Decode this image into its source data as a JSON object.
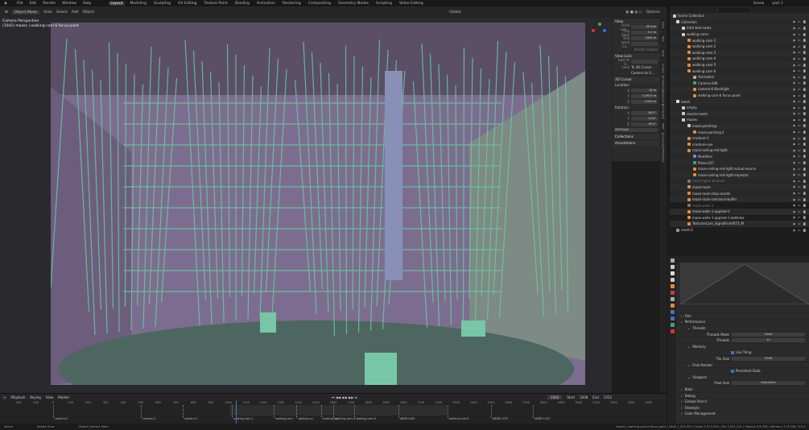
{
  "menu": [
    "File",
    "Edit",
    "Render",
    "Window",
    "Help"
  ],
  "workspaces": [
    "Layout",
    "Modeling",
    "Sculpting",
    "UV Editing",
    "Texture Paint",
    "Shading",
    "Animation",
    "Rendering",
    "Compositing",
    "Geometry Nodes",
    "Scripting",
    "Video Editing"
  ],
  "active_workspace": "Layout",
  "scene": "Scene",
  "view_layer": "part 1",
  "header": {
    "mode": "Object Mode",
    "view": "View",
    "select": "Select",
    "add": "Add",
    "object": "Object",
    "orientation": "Global",
    "options": "Options"
  },
  "viewport": {
    "title": "Camera Perspective",
    "subtitle": "(1042) mazes | walking-cam-6 focus-point"
  },
  "npanel": {
    "view_title": "View",
    "focal_label": "Focal Len...",
    "focal": "50 mm",
    "clip_start_label": "Clip Start",
    "clip_start": "0.1 m",
    "end_label": "End",
    "end": "1000 m",
    "local_label": "Local Ca...",
    "render_region": "Render Region",
    "view_lock": "View Lock",
    "lock_to_label": "Lock to O...",
    "lock_label": "Lock",
    "to_3d_cursor": "To 3D Cursor",
    "camera_to_view": "Camera to V...",
    "cursor_title": "3D Cursor",
    "location": "Location:",
    "loc": [
      [
        "X",
        "10 m"
      ],
      [
        "Y",
        "0.0973 m"
      ],
      [
        "Z",
        "2.953 m"
      ]
    ],
    "rotation": "Rotation:",
    "rot": [
      [
        "X",
        "84.2°"
      ],
      [
        "Y",
        "0.14°"
      ],
      [
        "Z",
        "45.2°"
      ]
    ],
    "rot_mode": "XYZ Euler",
    "collections": "Collections",
    "annotations": "Annotations"
  },
  "ntabs": [
    "Item",
    "Tool",
    "View",
    "Create",
    "Animation",
    "Relations",
    "BlenderKit",
    "AMP",
    "Screencast",
    "Modifiers"
  ],
  "outliner": {
    "root": "Scene Collection",
    "rows": [
      {
        "name": "Collection",
        "d": 0,
        "c": "#ddd"
      },
      {
        "name": "intro-test-cams",
        "d": 1,
        "c": "#ccc"
      },
      {
        "name": "walking-cams",
        "d": 1,
        "c": "#ccc"
      },
      {
        "name": "walking-cam-1",
        "d": 2,
        "c": "#e38b3c"
      },
      {
        "name": "walking-cam-2",
        "d": 2,
        "c": "#e38b3c"
      },
      {
        "name": "walking-cam-3",
        "d": 2,
        "c": "#e38b3c"
      },
      {
        "name": "walking-cam-4",
        "d": 2,
        "c": "#e38b3c"
      },
      {
        "name": "walking-cam-5",
        "d": 2,
        "c": "#e38b3c"
      },
      {
        "name": "walking-cam-6",
        "d": 2,
        "c": "#e38b3c"
      },
      {
        "name": "Animation",
        "d": 3,
        "c": "#aaa"
      },
      {
        "name": "Camera.008",
        "d": 3,
        "c": "#3fa37a"
      },
      {
        "name": "camera-6-flashlight",
        "d": 3,
        "c": "#e38b3c"
      },
      {
        "name": "walking-cam-6 focus-point",
        "d": 3,
        "c": "#e38b3c"
      },
      {
        "name": "mesh",
        "d": 0,
        "c": "#ddd"
      },
      {
        "name": "empty",
        "d": 1,
        "c": "#ccc"
      },
      {
        "name": "reactor-room",
        "d": 1,
        "c": "#ccc"
      },
      {
        "name": "mazes",
        "d": 1,
        "c": "#ccc"
      },
      {
        "name": "maze-paintings",
        "d": 2,
        "c": "#ccc"
      },
      {
        "name": "maze-painting-1",
        "d": 3,
        "c": "#e38b3c"
      },
      {
        "name": "creature-1",
        "d": 2,
        "c": "#e38b3c"
      },
      {
        "name": "creature-eye",
        "d": 2,
        "c": "#e38b3c"
      },
      {
        "name": "maze-ceiling-red-light",
        "d": 2,
        "c": "#e38b3c"
      },
      {
        "name": "Modifiers",
        "d": 3,
        "c": "#6b8fd6"
      },
      {
        "name": "Plane.037",
        "d": 3,
        "c": "#3fa37a"
      },
      {
        "name": "maze-ceiling-red-light-actual-source",
        "d": 3,
        "c": "#e38b3c"
      },
      {
        "name": "maze-ceiling-red-light-impostor",
        "d": 3,
        "c": "#e38b3c"
      },
      {
        "name": "maze-lights-boolean",
        "d": 2,
        "c": "#777"
      },
      {
        "name": "maze-room",
        "d": 2,
        "c": "#e38b3c"
      },
      {
        "name": "maze-room-disp-coords",
        "d": 2,
        "c": "#e38b3c"
      },
      {
        "name": "maze-room-entrance-buffer",
        "d": 2,
        "c": "#e38b3c"
      },
      {
        "name": "maze-walls-1",
        "d": 2,
        "c": "#777"
      },
      {
        "name": "maze-walls-1-applied-1",
        "d": 2,
        "c": "#e38b3c"
      },
      {
        "name": "maze-walls-1-applied-1-bottoms",
        "d": 2,
        "c": "#e38b3c"
      },
      {
        "name": "TexturesCom_SignalFine0073_M",
        "d": 2,
        "c": "#e38b3c"
      },
      {
        "name": "mesh-2",
        "d": 0,
        "c": "#999"
      }
    ]
  },
  "properties": {
    "sections": [
      {
        "name": "Film",
        "type": "panel"
      },
      {
        "name": "Performance",
        "type": "panel"
      },
      {
        "name": "Threads",
        "type": "sub"
      },
      {
        "name": "Threads Mode",
        "value": "Fixed",
        "type": "field"
      },
      {
        "name": "Threads",
        "value": "12",
        "type": "field"
      },
      {
        "name": "Memory",
        "type": "sub"
      },
      {
        "name": "Use Tiling",
        "type": "check"
      },
      {
        "name": "Tile Size",
        "value": "2048",
        "type": "field"
      },
      {
        "name": "Final Render",
        "type": "sub"
      },
      {
        "name": "Persistent Data",
        "type": "check"
      },
      {
        "name": "Viewport",
        "type": "sub"
      },
      {
        "name": "Pixel Size",
        "value": "Automatic",
        "type": "field"
      },
      {
        "name": "Bake",
        "type": "panel"
      },
      {
        "name": "Debug",
        "type": "panel"
      },
      {
        "name": "Grease Pencil",
        "type": "panel"
      },
      {
        "name": "Freestyle",
        "type": "panel"
      },
      {
        "name": "Color Management",
        "type": "panel"
      }
    ]
  },
  "timeline": {
    "playback": "Playback",
    "keying": "Keying",
    "view": "View",
    "marker": "Marker",
    "current": "1042",
    "start_label": "Start",
    "start": "1008",
    "end_label": "End",
    "end": "2252",
    "ticks": [
      "-200",
      "-100",
      "0",
      "100",
      "200",
      "300",
      "400",
      "500",
      "600",
      "700",
      "800",
      "900",
      "1000",
      "1100",
      "1200",
      "1300",
      "1400",
      "1500",
      "1600",
      "1700",
      "1800",
      "1900",
      "2000",
      "2100",
      "2200",
      "2300",
      "2400",
      "2500",
      "2600",
      "2700",
      "2800",
      "2900",
      "3000",
      "3100",
      "3200",
      "3300",
      "3400"
    ],
    "markers": [
      {
        "label": "camera-2",
        "f": 0
      },
      {
        "label": "camera-3",
        "f": 500
      },
      {
        "label": "camera-1",
        "f": 740
      },
      {
        "label": "walking-cam-1",
        "f": 1020
      },
      {
        "label": "walking-cam",
        "f": 1260
      },
      {
        "label": "walking-ca",
        "f": 1390
      },
      {
        "label": "walking-ca",
        "f": 1530
      },
      {
        "label": "walking-cam-4",
        "f": 1600
      },
      {
        "label": "walking-cam-5",
        "f": 1720
      },
      {
        "label": "dBDR+405",
        "f": 1970
      },
      {
        "label": "walking-cam-6",
        "f": 2250
      },
      {
        "label": "dBDR+105",
        "f": 2500
      },
      {
        "label": "dBDR+205",
        "f": 2740
      }
    ]
  },
  "status": {
    "select": "Select",
    "rotate": "Rotate View",
    "context": "Object Context Menu",
    "stats": "mazes | walking-cam-6 focus-point | Verts 1,924,954 | Faces 1,913,090 | Tris 3,521,224 | Objects 0/3,358 | Memory 3.25 GiB | 3.6.2"
  }
}
